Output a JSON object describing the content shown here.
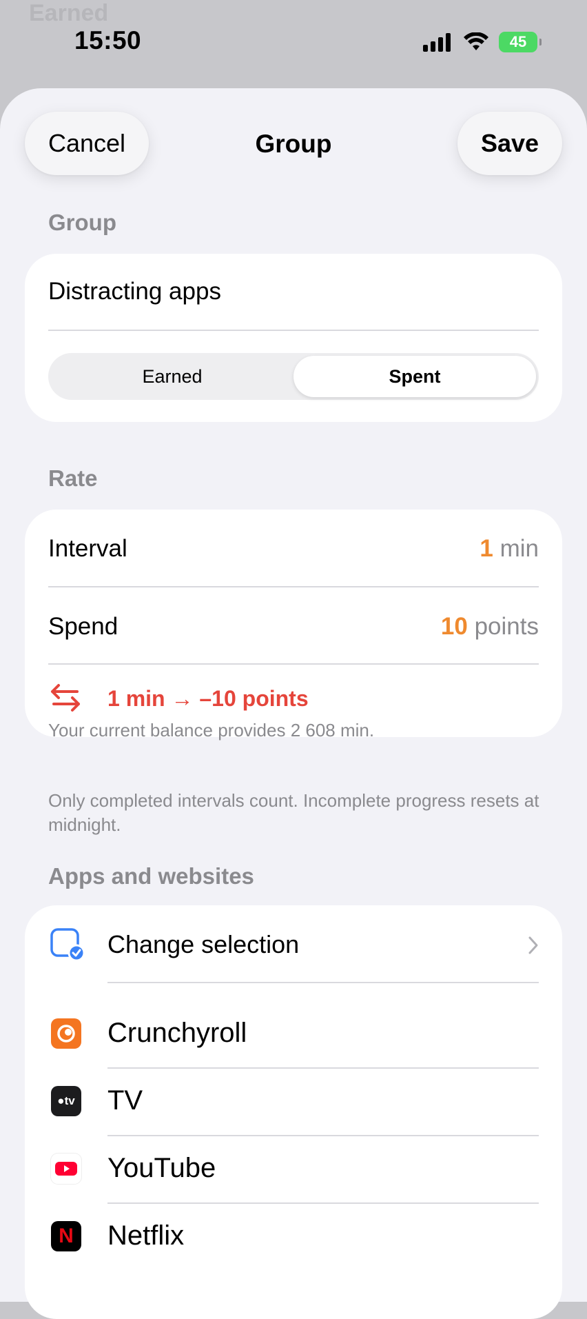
{
  "background": {
    "ghost_title": "Earned"
  },
  "status_bar": {
    "time": "15:50",
    "battery": "45"
  },
  "sheet": {
    "cancel_label": "Cancel",
    "title": "Group",
    "save_label": "Save"
  },
  "group_section": {
    "header": "Group",
    "name_value": "Distracting apps",
    "segments": [
      "Earned",
      "Spent"
    ],
    "selected_segment": "Spent"
  },
  "rate_section": {
    "header": "Rate",
    "interval_label": "Interval",
    "interval_value": "1",
    "interval_unit": "min",
    "spend_label": "Spend",
    "spend_value": "10",
    "spend_unit": "points",
    "summary": "1 min → –10 points",
    "balance_note": "Your current balance provides 2 608 min."
  },
  "footnote": "Only completed intervals count. Incomplete progress resets at midnight.",
  "apps_section": {
    "header": "Apps and websites",
    "change_label": "Change selection",
    "apps": [
      {
        "name": "Crunchyroll",
        "icon": "crunchyroll-icon",
        "color": "#f47521"
      },
      {
        "name": "TV",
        "icon": "apple-tv-icon",
        "color": "#1c1c1e"
      },
      {
        "name": "YouTube",
        "icon": "youtube-icon",
        "color": "#ff0033"
      },
      {
        "name": "Netflix",
        "icon": "netflix-icon",
        "color": "#e50914"
      }
    ]
  },
  "colors": {
    "accent_orange": "#ef8a2f",
    "spend_red": "#e5453b",
    "system_blue": "#3a82f7"
  }
}
